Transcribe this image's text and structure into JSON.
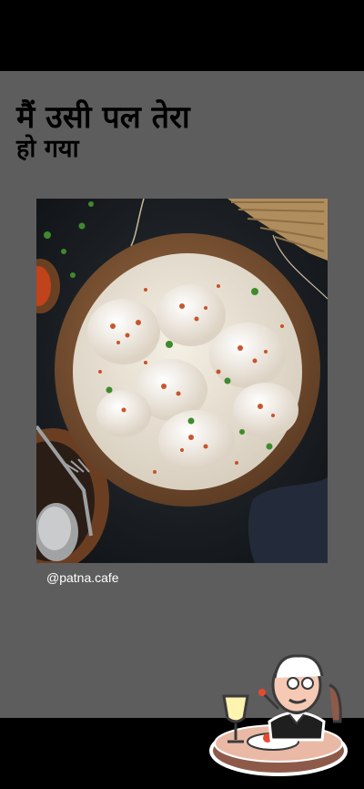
{
  "post": {
    "headline_line1": "मैं उसी पल तेरा",
    "headline_line2": "हो गया",
    "photo_alt": "",
    "handle": "@patna.cafe"
  },
  "colors": {
    "panel_background": "#5d5d5d",
    "bars": "#000000",
    "handle_text": "#ffffff"
  }
}
